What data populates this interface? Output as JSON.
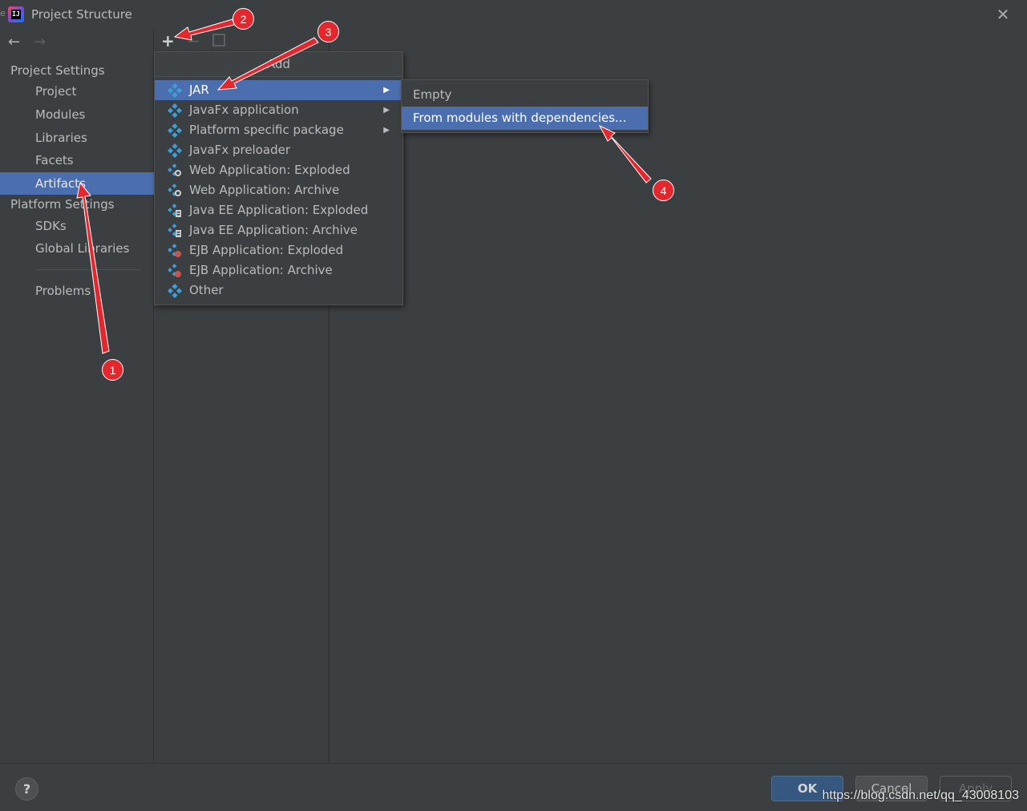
{
  "window": {
    "title": "Project Structure",
    "app_icon_text": "IJ",
    "edge_glyph": "e",
    "close_glyph": "✕"
  },
  "navigation": {
    "back_glyph": "←",
    "forward_glyph": "→"
  },
  "sidebar": {
    "project_settings_heading": "Project Settings",
    "project_settings_items": [
      {
        "label": "Project"
      },
      {
        "label": "Modules"
      },
      {
        "label": "Libraries"
      },
      {
        "label": "Facets"
      },
      {
        "label": "Artifacts",
        "selected": true
      }
    ],
    "platform_settings_heading": "Platform Settings",
    "platform_settings_items": [
      {
        "label": "SDKs"
      },
      {
        "label": "Global Libraries"
      }
    ],
    "problems_label": "Problems"
  },
  "toolbar": {
    "add_glyph": "+",
    "remove_glyph": "−"
  },
  "add_menu": {
    "title": "Add",
    "items": [
      {
        "label": "JAR",
        "icon": "artifact-icon",
        "submenu": true,
        "selected": true
      },
      {
        "label": "JavaFx application",
        "icon": "artifact-icon",
        "submenu": true
      },
      {
        "label": "Platform specific package",
        "icon": "artifact-icon",
        "submenu": true
      },
      {
        "label": "JavaFx preloader",
        "icon": "artifact-icon"
      },
      {
        "label": "Web Application: Exploded",
        "icon": "web-artifact-icon"
      },
      {
        "label": "Web Application: Archive",
        "icon": "web-artifact-icon"
      },
      {
        "label": "Java EE Application: Exploded",
        "icon": "javaee-artifact-icon"
      },
      {
        "label": "Java EE Application: Archive",
        "icon": "javaee-artifact-icon"
      },
      {
        "label": "EJB Application: Exploded",
        "icon": "ejb-artifact-icon"
      },
      {
        "label": "EJB Application: Archive",
        "icon": "ejb-artifact-icon"
      },
      {
        "label": "Other",
        "icon": "artifact-icon"
      }
    ],
    "submenu_arrow": "▶"
  },
  "jar_submenu": {
    "items": [
      {
        "label": "Empty"
      },
      {
        "label": "From modules with dependencies...",
        "selected": true
      }
    ]
  },
  "footer": {
    "help_label": "?",
    "ok_label": "OK",
    "cancel_label": "Cancel",
    "apply_label": "Apply",
    "watermark": "https://blog.csdn.net/qq_43008103"
  },
  "annotations": {
    "badges": [
      "1",
      "2",
      "3",
      "4"
    ],
    "color": "#e6262d"
  },
  "colors": {
    "background": "#3c3f41",
    "selection": "#4b6eaf",
    "ok_button": "#365880",
    "artifact_icon": "#3d9fd8"
  }
}
